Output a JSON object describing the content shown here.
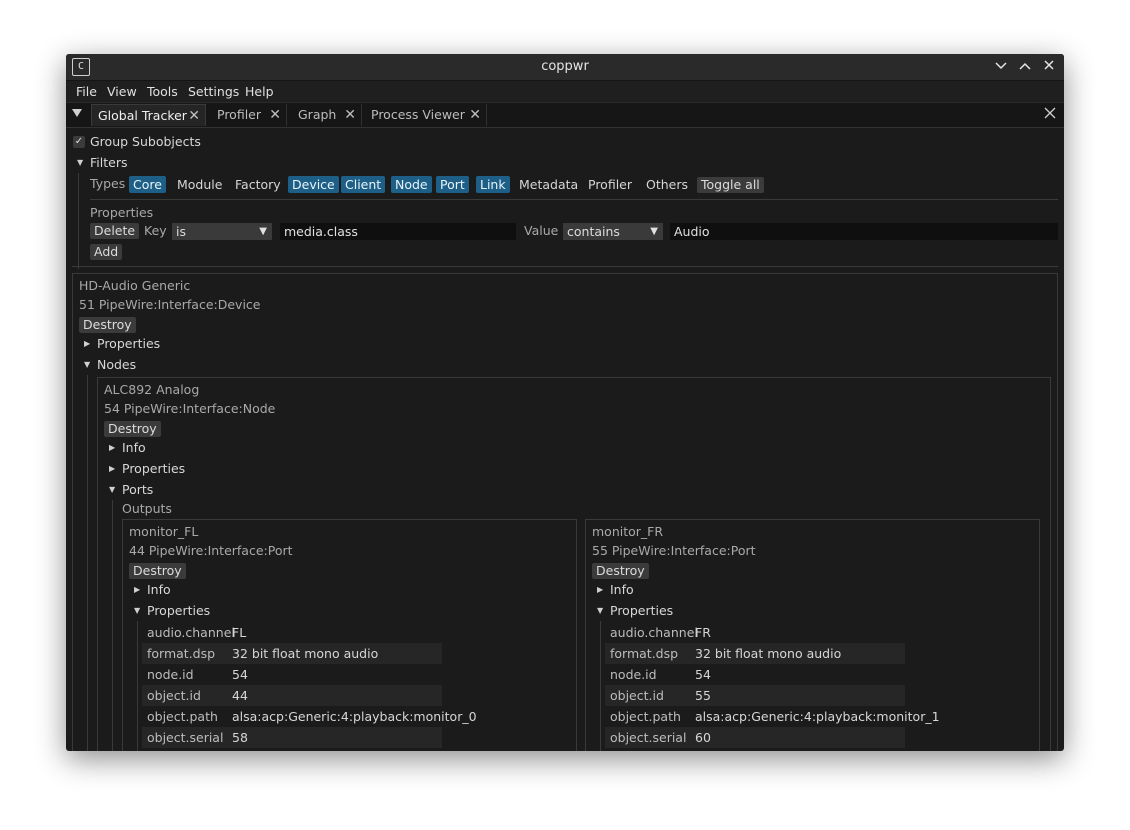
{
  "window": {
    "title": "coppwr",
    "app_icon": "C"
  },
  "menu": [
    "File",
    "View",
    "Tools",
    "Settings",
    "Help"
  ],
  "tabs": [
    {
      "label": "Global Tracker",
      "active": true
    },
    {
      "label": "Profiler"
    },
    {
      "label": "Graph"
    },
    {
      "label": "Process Viewer"
    }
  ],
  "filters": {
    "group_subobjects": "Group Subobjects",
    "filters_label": "Filters",
    "types_label": "Types",
    "types": [
      {
        "label": "Core",
        "on": true
      },
      {
        "label": "Module",
        "on": false
      },
      {
        "label": "Factory",
        "on": false
      },
      {
        "label": "Device",
        "on": true
      },
      {
        "label": "Client",
        "on": true
      },
      {
        "label": "Node",
        "on": true
      },
      {
        "label": "Port",
        "on": true
      },
      {
        "label": "Link",
        "on": true
      },
      {
        "label": "Metadata",
        "on": false
      },
      {
        "label": "Profiler",
        "on": false
      },
      {
        "label": "Others",
        "on": false
      }
    ],
    "toggle_all": "Toggle all",
    "properties_label": "Properties",
    "delete": "Delete",
    "key_label": "Key",
    "key_op": "is",
    "key_value": "media.class",
    "value_label": "Value",
    "value_op": "contains",
    "value_value": "Audio",
    "add": "Add"
  },
  "device": {
    "name": "HD-Audio Generic",
    "id_line": "51  PipeWire:Interface:Device",
    "destroy": "Destroy",
    "properties": "Properties",
    "nodes": "Nodes",
    "node": {
      "name": "ALC892 Analog",
      "id_line": "54  PipeWire:Interface:Node",
      "destroy": "Destroy",
      "info": "Info",
      "properties": "Properties",
      "ports": "Ports",
      "outputs": "Outputs",
      "port_left": {
        "name": "monitor_FL",
        "id_line": "44  PipeWire:Interface:Port",
        "destroy": "Destroy",
        "info": "Info",
        "properties": "Properties",
        "props": [
          {
            "k": "audio.channel",
            "v": "FL"
          },
          {
            "k": "format.dsp",
            "v": "32 bit float mono audio"
          },
          {
            "k": "node.id",
            "v": "54"
          },
          {
            "k": "object.id",
            "v": "44"
          },
          {
            "k": "object.path",
            "v": "alsa:acp:Generic:4:playback:monitor_0"
          },
          {
            "k": "object.serial",
            "v": "58"
          }
        ]
      },
      "port_right": {
        "name": "monitor_FR",
        "id_line": "55  PipeWire:Interface:Port",
        "destroy": "Destroy",
        "info": "Info",
        "properties": "Properties",
        "props": [
          {
            "k": "audio.channel",
            "v": "FR"
          },
          {
            "k": "format.dsp",
            "v": "32 bit float mono audio"
          },
          {
            "k": "node.id",
            "v": "54"
          },
          {
            "k": "object.id",
            "v": "55"
          },
          {
            "k": "object.path",
            "v": "alsa:acp:Generic:4:playback:monitor_1"
          },
          {
            "k": "object.serial",
            "v": "60"
          }
        ]
      }
    }
  },
  "colors": {
    "accent": "#1d5f86",
    "background": "#1b1b1b",
    "button": "#3b3b3b"
  }
}
